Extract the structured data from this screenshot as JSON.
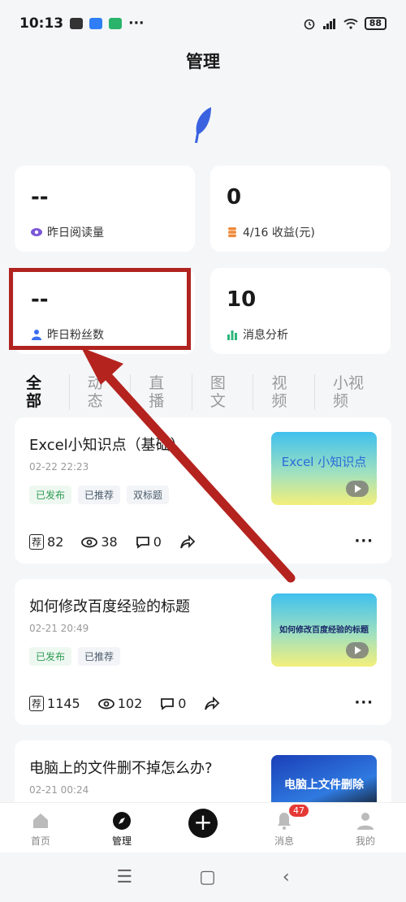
{
  "status_bar": {
    "time": "10:13",
    "dots": "···",
    "battery": "88"
  },
  "header": {
    "title": "管理"
  },
  "stats": [
    {
      "value": "--",
      "label": "昨日阅读量",
      "icon": "eye-icon"
    },
    {
      "value": "0",
      "label": "4/16 收益(元)",
      "icon": "coins-icon"
    },
    {
      "value": "--",
      "label": "昨日粉丝数",
      "icon": "person-icon"
    },
    {
      "value": "10",
      "label": "消息分析",
      "icon": "bar-chart-icon"
    }
  ],
  "tabs": [
    "全部",
    "动态",
    "直播",
    "图文",
    "视频",
    "小视频"
  ],
  "posts": [
    {
      "title": "Excel小知识点（基础）",
      "date": "02-22 22:23",
      "tags": [
        "已发布",
        "已推荐",
        "双标题"
      ],
      "thumb_text": "Excel 小知识点",
      "recommend": "82",
      "views": "38",
      "comments": "0"
    },
    {
      "title": "如何修改百度经验的标题",
      "date": "02-21 20:49",
      "tags": [
        "已发布",
        "已推荐"
      ],
      "thumb_text": "如何修改百度经验的标题",
      "recommend": "1145",
      "views": "102",
      "comments": "0"
    },
    {
      "title": "电脑上的文件删不掉怎么办?",
      "date": "02-21 00:24",
      "thumb_text": "电脑上文件删除"
    }
  ],
  "recommend_glyph": "荐",
  "more_glyph": "···",
  "bottom_nav": {
    "home": "首页",
    "manage": "管理",
    "plus": "+",
    "messages": "消息",
    "messages_badge": "47",
    "mine": "我的"
  },
  "sys_nav": {
    "menu": "☰",
    "home": "▢",
    "back": "‹"
  },
  "colors": {
    "highlight": "#b0231f",
    "accent_green": "#2e9a52",
    "arrow": "#b5231f"
  }
}
